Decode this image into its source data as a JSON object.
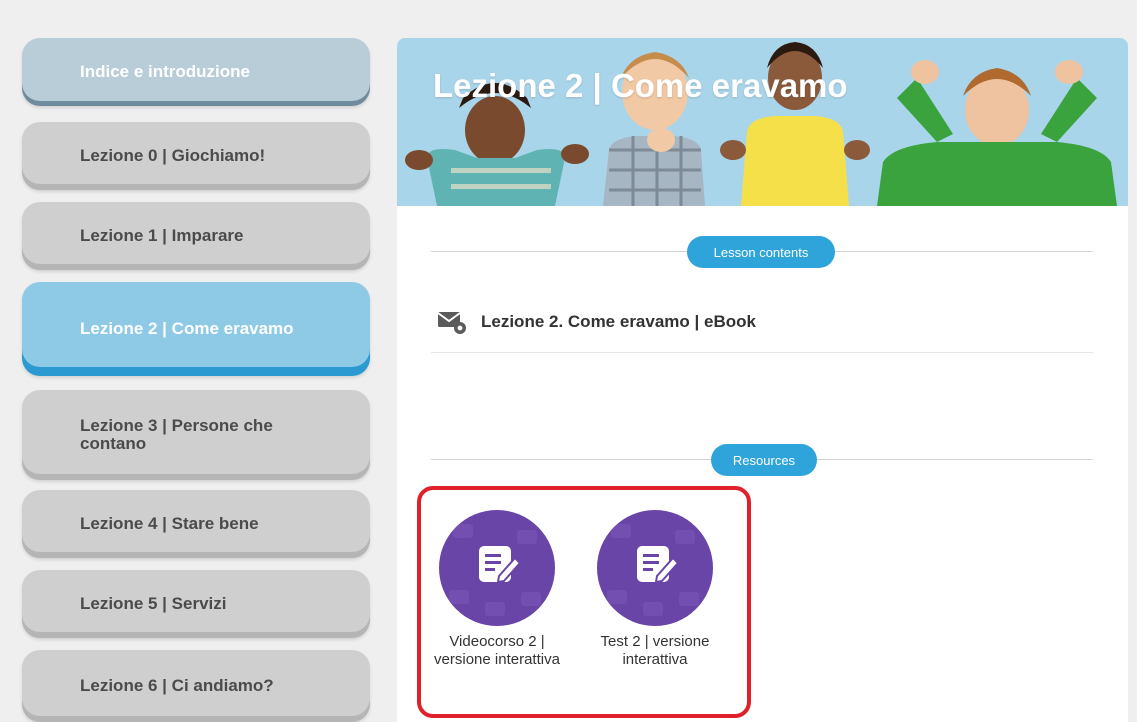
{
  "sidebar": {
    "items": [
      {
        "label": "Indice e introduzione",
        "state": "intro"
      },
      {
        "label": "Lezione 0 | Giochiamo!",
        "state": "normal"
      },
      {
        "label": "Lezione 1 | Imparare",
        "state": "normal"
      },
      {
        "label": "Lezione 2 | Come eravamo",
        "state": "active"
      },
      {
        "label": "Lezione 3 | Persone che contano",
        "state": "normal"
      },
      {
        "label": "Lezione 4 | Stare bene",
        "state": "normal"
      },
      {
        "label": "Lezione 5 | Servizi",
        "state": "normal"
      },
      {
        "label": "Lezione 6 | Ci andiamo?",
        "state": "normal"
      }
    ]
  },
  "main": {
    "title": "Lezione 2 | Come eravamo",
    "lesson_contents_label": "Lesson contents",
    "ebook": {
      "label": "Lezione 2. Come eravamo | eBook",
      "icon": "envelope-gear-icon"
    },
    "resources_label": "Resources",
    "resources": [
      {
        "label": "Videocorso 2 | versione interattiva",
        "icon": "edit-note-icon"
      },
      {
        "label": "Test 2 | versione interattiva",
        "icon": "edit-note-icon"
      }
    ]
  },
  "colors": {
    "accent": "#2ea4da",
    "active_nav": "#8ec9e6",
    "intro_nav": "#b9cdd8",
    "inactive_nav": "#cfcfcf",
    "resource_circle": "#6a45a8",
    "highlight_frame": "#e0202a",
    "banner": "#a9d5ea"
  }
}
